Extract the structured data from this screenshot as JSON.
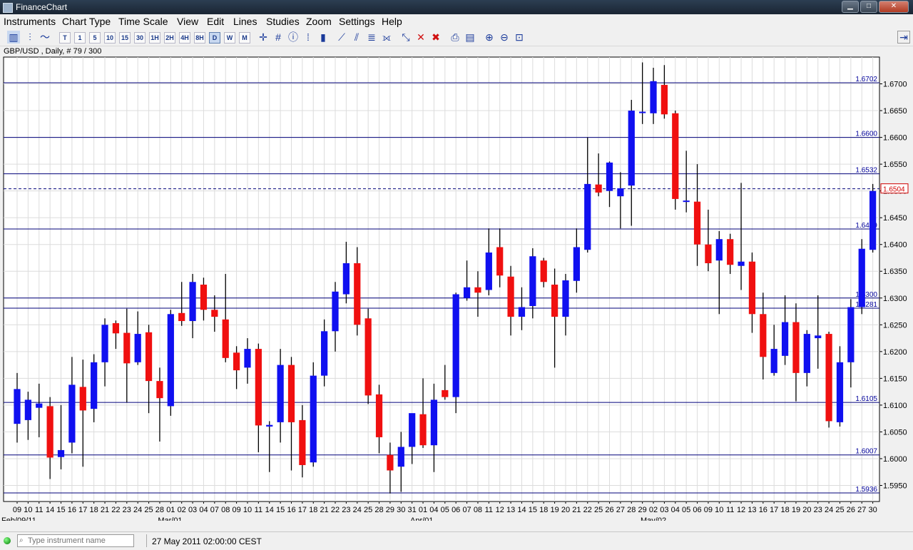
{
  "window": {
    "title": "FinanceChart"
  },
  "menu": [
    "Instruments",
    "Chart Type",
    "Time Scale",
    "View",
    "Edit",
    "Lines",
    "Studies",
    "Zoom",
    "Settings",
    "Help"
  ],
  "toolbar": {
    "timeframes": [
      "T",
      "1",
      "5",
      "10",
      "15",
      "30",
      "1H",
      "2H",
      "4H",
      "8H",
      "D",
      "W",
      "M"
    ],
    "selected_timeframe": "D"
  },
  "info": {
    "label": "GBP/USD , Daily, # 79 / 300"
  },
  "status": {
    "instrument_placeholder": "Type instrument name",
    "datetime": "27 May 2011 02:00:00 CEST"
  },
  "chart_data": {
    "type": "candlestick",
    "instrument": "GBP/USD",
    "ylim": [
      1.592,
      1.675
    ],
    "y_ticks": [
      "1.5950",
      "1.6000",
      "1.6050",
      "1.6100",
      "1.6150",
      "1.6200",
      "1.6250",
      "1.6300",
      "1.6350",
      "1.6400",
      "1.6450",
      "1.6500",
      "1.6550",
      "1.6600",
      "1.6650",
      "1.6700"
    ],
    "h_lines": [
      1.6702,
      1.66,
      1.6532,
      1.6429,
      1.63,
      1.6281,
      1.6105,
      1.6007,
      1.5936
    ],
    "h_line_labels": [
      "1.6702",
      "1.6600",
      "1.6532",
      "1.6429",
      "1.6300",
      "1.6281",
      "1.6105",
      "1.6007",
      "1.5936"
    ],
    "current_price": 1.6504,
    "current_price_label": "1.6504",
    "x_labels": [
      "09",
      "10",
      "11",
      "14",
      "15",
      "16",
      "17",
      "18",
      "21",
      "22",
      "23",
      "24",
      "25",
      "28",
      "01",
      "02",
      "03",
      "04",
      "07",
      "08",
      "09",
      "10",
      "11",
      "14",
      "15",
      "16",
      "17",
      "18",
      "21",
      "22",
      "23",
      "24",
      "25",
      "28",
      "29",
      "30",
      "31",
      "01",
      "04",
      "05",
      "06",
      "07",
      "08",
      "11",
      "12",
      "13",
      "14",
      "15",
      "18",
      "19",
      "20",
      "21",
      "22",
      "25",
      "26",
      "27",
      "28",
      "29",
      "02",
      "03",
      "04",
      "05",
      "06",
      "09",
      "10",
      "11",
      "12",
      "13",
      "16",
      "17",
      "18",
      "19",
      "20",
      "23",
      "24",
      "25",
      "26",
      "27",
      "30"
    ],
    "month_labels": [
      {
        "label": "Feb/09/11",
        "index": 0
      },
      {
        "label": "Mar/01",
        "index": 14
      },
      {
        "label": "Apr/01",
        "index": 37
      },
      {
        "label": "May/02",
        "index": 58
      }
    ],
    "candles": [
      {
        "o": 1.6065,
        "h": 1.616,
        "l": 1.603,
        "c": 1.613
      },
      {
        "o": 1.6072,
        "h": 1.6125,
        "l": 1.6035,
        "c": 1.611
      },
      {
        "o": 1.6095,
        "h": 1.614,
        "l": 1.604,
        "c": 1.6103
      },
      {
        "o": 1.6098,
        "h": 1.6115,
        "l": 1.5962,
        "c": 1.6002
      },
      {
        "o": 1.6003,
        "h": 1.61,
        "l": 1.598,
        "c": 1.6016
      },
      {
        "o": 1.603,
        "h": 1.619,
        "l": 1.601,
        "c": 1.6138
      },
      {
        "o": 1.6134,
        "h": 1.6185,
        "l": 1.5985,
        "c": 1.609
      },
      {
        "o": 1.6093,
        "h": 1.6195,
        "l": 1.6068,
        "c": 1.618
      },
      {
        "o": 1.618,
        "h": 1.6262,
        "l": 1.6135,
        "c": 1.625
      },
      {
        "o": 1.6253,
        "h": 1.6258,
        "l": 1.6205,
        "c": 1.6234
      },
      {
        "o": 1.6235,
        "h": 1.628,
        "l": 1.6105,
        "c": 1.6178
      },
      {
        "o": 1.618,
        "h": 1.6275,
        "l": 1.6175,
        "c": 1.6233
      },
      {
        "o": 1.6236,
        "h": 1.625,
        "l": 1.6085,
        "c": 1.6145
      },
      {
        "o": 1.6145,
        "h": 1.617,
        "l": 1.6032,
        "c": 1.6113
      },
      {
        "o": 1.6098,
        "h": 1.6278,
        "l": 1.608,
        "c": 1.627
      },
      {
        "o": 1.6272,
        "h": 1.633,
        "l": 1.6248,
        "c": 1.6257
      },
      {
        "o": 1.6257,
        "h": 1.6345,
        "l": 1.6225,
        "c": 1.633
      },
      {
        "o": 1.6325,
        "h": 1.6338,
        "l": 1.6258,
        "c": 1.6278
      },
      {
        "o": 1.6278,
        "h": 1.6305,
        "l": 1.6237,
        "c": 1.6265
      },
      {
        "o": 1.626,
        "h": 1.6345,
        "l": 1.618,
        "c": 1.6188
      },
      {
        "o": 1.6198,
        "h": 1.621,
        "l": 1.613,
        "c": 1.6165
      },
      {
        "o": 1.617,
        "h": 1.6225,
        "l": 1.614,
        "c": 1.6205
      },
      {
        "o": 1.6205,
        "h": 1.6215,
        "l": 1.6012,
        "c": 1.6062
      },
      {
        "o": 1.606,
        "h": 1.607,
        "l": 1.5975,
        "c": 1.6063
      },
      {
        "o": 1.6068,
        "h": 1.6205,
        "l": 1.603,
        "c": 1.6175
      },
      {
        "o": 1.6175,
        "h": 1.619,
        "l": 1.5978,
        "c": 1.6068
      },
      {
        "o": 1.6072,
        "h": 1.61,
        "l": 1.5965,
        "c": 1.5988
      },
      {
        "o": 1.5993,
        "h": 1.618,
        "l": 1.5985,
        "c": 1.6155
      },
      {
        "o": 1.6155,
        "h": 1.626,
        "l": 1.6135,
        "c": 1.6238
      },
      {
        "o": 1.6238,
        "h": 1.633,
        "l": 1.62,
        "c": 1.6312
      },
      {
        "o": 1.6307,
        "h": 1.6405,
        "l": 1.629,
        "c": 1.6365
      },
      {
        "o": 1.6365,
        "h": 1.6395,
        "l": 1.623,
        "c": 1.625
      },
      {
        "o": 1.6262,
        "h": 1.628,
        "l": 1.6102,
        "c": 1.6118
      },
      {
        "o": 1.612,
        "h": 1.6138,
        "l": 1.601,
        "c": 1.604
      },
      {
        "o": 1.6007,
        "h": 1.603,
        "l": 1.5935,
        "c": 1.5978
      },
      {
        "o": 1.5985,
        "h": 1.605,
        "l": 1.5938,
        "c": 1.6022
      },
      {
        "o": 1.6022,
        "h": 1.6082,
        "l": 1.599,
        "c": 1.6085
      },
      {
        "o": 1.6083,
        "h": 1.615,
        "l": 1.602,
        "c": 1.6025
      },
      {
        "o": 1.6025,
        "h": 1.614,
        "l": 1.5975,
        "c": 1.611
      },
      {
        "o": 1.6128,
        "h": 1.6175,
        "l": 1.611,
        "c": 1.6115
      },
      {
        "o": 1.6115,
        "h": 1.631,
        "l": 1.6085,
        "c": 1.6307
      },
      {
        "o": 1.63,
        "h": 1.637,
        "l": 1.6295,
        "c": 1.632
      },
      {
        "o": 1.632,
        "h": 1.635,
        "l": 1.6265,
        "c": 1.631
      },
      {
        "o": 1.6315,
        "h": 1.643,
        "l": 1.6305,
        "c": 1.6385
      },
      {
        "o": 1.6395,
        "h": 1.643,
        "l": 1.632,
        "c": 1.6342
      },
      {
        "o": 1.634,
        "h": 1.636,
        "l": 1.623,
        "c": 1.6265
      },
      {
        "o": 1.6265,
        "h": 1.632,
        "l": 1.624,
        "c": 1.6283
      },
      {
        "o": 1.6285,
        "h": 1.6393,
        "l": 1.6262,
        "c": 1.6378
      },
      {
        "o": 1.637,
        "h": 1.6375,
        "l": 1.632,
        "c": 1.633
      },
      {
        "o": 1.6325,
        "h": 1.6355,
        "l": 1.617,
        "c": 1.6265
      },
      {
        "o": 1.6265,
        "h": 1.6345,
        "l": 1.623,
        "c": 1.6333
      },
      {
        "o": 1.6332,
        "h": 1.643,
        "l": 1.631,
        "c": 1.6395
      },
      {
        "o": 1.639,
        "h": 1.66,
        "l": 1.6385,
        "c": 1.6513
      },
      {
        "o": 1.6512,
        "h": 1.657,
        "l": 1.649,
        "c": 1.6497
      },
      {
        "o": 1.65,
        "h": 1.6555,
        "l": 1.647,
        "c": 1.6553
      },
      {
        "o": 1.649,
        "h": 1.6535,
        "l": 1.643,
        "c": 1.6505
      },
      {
        "o": 1.651,
        "h": 1.667,
        "l": 1.6435,
        "c": 1.665
      },
      {
        "o": 1.6648,
        "h": 1.674,
        "l": 1.6625,
        "c": 1.6648
      },
      {
        "o": 1.6645,
        "h": 1.673,
        "l": 1.6625,
        "c": 1.6705
      },
      {
        "o": 1.6698,
        "h": 1.6735,
        "l": 1.6635,
        "c": 1.6643
      },
      {
        "o": 1.6645,
        "h": 1.665,
        "l": 1.6465,
        "c": 1.6485
      },
      {
        "o": 1.648,
        "h": 1.6575,
        "l": 1.646,
        "c": 1.6482
      },
      {
        "o": 1.648,
        "h": 1.655,
        "l": 1.636,
        "c": 1.64
      },
      {
        "o": 1.64,
        "h": 1.6465,
        "l": 1.635,
        "c": 1.6365
      },
      {
        "o": 1.637,
        "h": 1.6425,
        "l": 1.627,
        "c": 1.641
      },
      {
        "o": 1.641,
        "h": 1.642,
        "l": 1.6345,
        "c": 1.6362
      },
      {
        "o": 1.636,
        "h": 1.6515,
        "l": 1.6315,
        "c": 1.6368
      },
      {
        "o": 1.6368,
        "h": 1.6385,
        "l": 1.6235,
        "c": 1.627
      },
      {
        "o": 1.627,
        "h": 1.631,
        "l": 1.6148,
        "c": 1.619
      },
      {
        "o": 1.616,
        "h": 1.625,
        "l": 1.6155,
        "c": 1.6205
      },
      {
        "o": 1.6192,
        "h": 1.6305,
        "l": 1.6175,
        "c": 1.6255
      },
      {
        "o": 1.6255,
        "h": 1.629,
        "l": 1.6107,
        "c": 1.616
      },
      {
        "o": 1.616,
        "h": 1.624,
        "l": 1.6135,
        "c": 1.6233
      },
      {
        "o": 1.6225,
        "h": 1.6305,
        "l": 1.6168,
        "c": 1.623
      },
      {
        "o": 1.6233,
        "h": 1.6237,
        "l": 1.6058,
        "c": 1.607
      },
      {
        "o": 1.6068,
        "h": 1.621,
        "l": 1.606,
        "c": 1.618
      },
      {
        "o": 1.618,
        "h": 1.6298,
        "l": 1.6133,
        "c": 1.6283
      },
      {
        "o": 1.6283,
        "h": 1.641,
        "l": 1.627,
        "c": 1.6392
      },
      {
        "o": 1.639,
        "h": 1.6513,
        "l": 1.6385,
        "c": 1.65
      }
    ]
  }
}
